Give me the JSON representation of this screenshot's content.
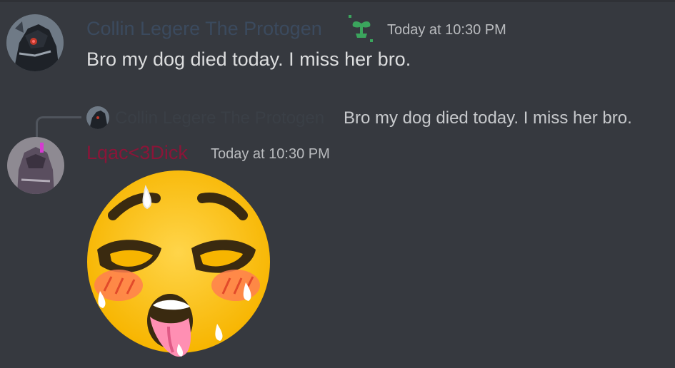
{
  "messages": [
    {
      "author": "Collin Legere The Protogen",
      "timestamp": "Today at 10:30 PM",
      "text": "Bro my dog died today. I miss her bro.",
      "badge_icon": "sprout-nitro-icon",
      "author_color": "#3b4a5e"
    },
    {
      "reply_to": {
        "author": "Collin Legere The Protogen",
        "text": "Bro my dog died today. I miss her bro."
      },
      "author": "Lqac<3Dick",
      "timestamp": "Today at 10:30 PM",
      "attachment": "flushed-ahegao-emoji",
      "author_color": "#8a1538"
    }
  ],
  "theme": {
    "background": "#36393f",
    "text": "#dcddde",
    "muted": "#b9bbbe",
    "emoji_yellow": "#fcc21b",
    "badge_green": "#3ba55d"
  }
}
